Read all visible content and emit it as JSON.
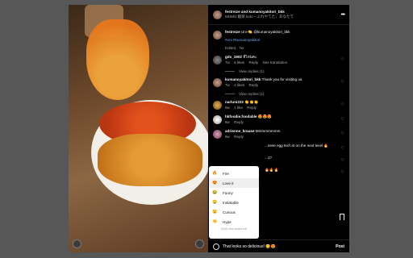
{
  "post": {
    "author": "festreize and kumanoyakitori_bkk",
    "subtitle": "MUMU 鮨楽 kuto・ぶれやてた、あなたて"
  },
  "caption": {
    "author": "festreize",
    "text": "Uni-🍋 @kumanoyakitori_bkk",
    "mention": "#uni #kumanoyakitori",
    "edited": "Edited · 7w"
  },
  "comments": [
    {
      "user": "gds_1902",
      "text": "ที่ไหนคะ",
      "age": "7w",
      "likes": "5 likes",
      "reply": "Reply",
      "translate": "See translation",
      "replies_label": "View replies (1)"
    },
    {
      "user": "kumanoyakitori_bkk",
      "text": "Thank you for visiting us.",
      "age": "7w",
      "likes": "2 likes",
      "reply": "Reply",
      "translate": "",
      "replies_label": "View replies (1)"
    },
    {
      "user": "narluni222",
      "text": "👏👏👏",
      "age": "6w",
      "likes": "1 like",
      "reply": "Reply",
      "translate": "",
      "replies_label": ""
    },
    {
      "user": "hkfoodie.foodable",
      "text": "😍😍😍",
      "age": "6w",
      "likes": "",
      "reply": "Reply",
      "translate": "",
      "replies_label": ""
    },
    {
      "user": "adrienne_krause",
      "text": "Mmmmmmmm",
      "age": "6w",
      "likes": "",
      "reply": "Reply",
      "translate": "",
      "replies_label": ""
    }
  ],
  "partial_comment_text": "...nese egg tech is on the next level 🔥",
  "partial_comment_text2": "...1?",
  "partial_comment_text3": "🔥🔥🔥",
  "reactions": {
    "items": [
      {
        "icon": "🔥",
        "label": "Fire"
      },
      {
        "icon": "😍",
        "label": "Love it"
      },
      {
        "icon": "😂",
        "label": "Funny"
      },
      {
        "icon": "🤤",
        "label": "Instatable"
      },
      {
        "icon": "😯",
        "label": "Curious"
      },
      {
        "icon": "👏",
        "label": "Hype"
      }
    ],
    "footer": "AI/ML free replies left"
  },
  "composer": {
    "text": "That looks so delicious! 😋😍",
    "post_label": "Post"
  },
  "colors": {
    "accent_blue": "#6ea7f0",
    "backdrop": "#575757"
  }
}
